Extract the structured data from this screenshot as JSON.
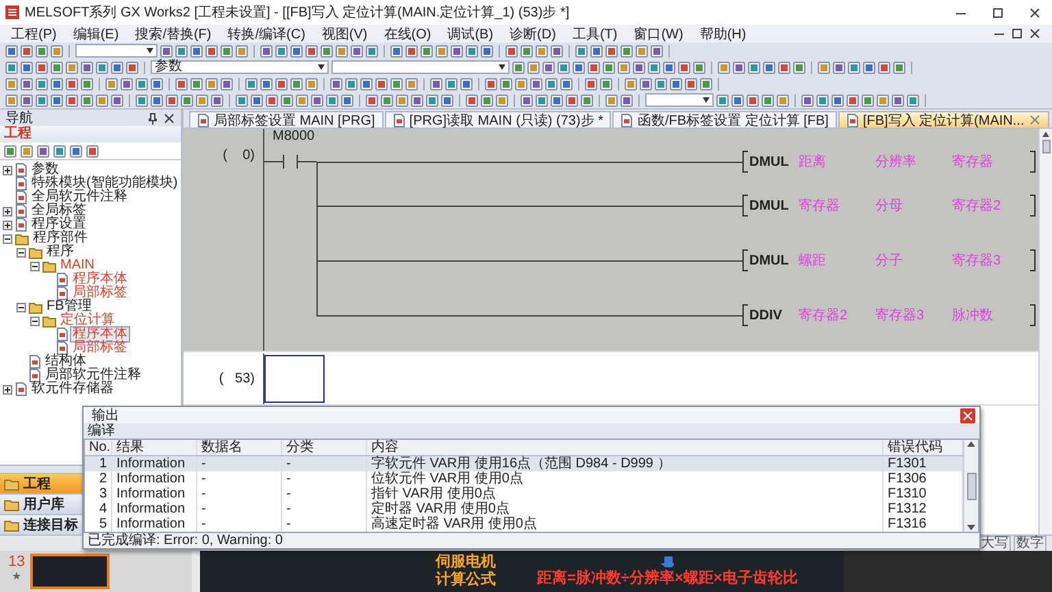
{
  "window": {
    "title": "MELSOFT系列 GX Works2 [工程未设置] - [[FB]写入 定位计算(MAIN.定位计算_1) (53)步 *]"
  },
  "menu": [
    "工程(P)",
    "编辑(E)",
    "搜索/替换(F)",
    "转换/编译(C)",
    "视图(V)",
    "在线(O)",
    "调试(B)",
    "诊断(D)",
    "工具(T)",
    "窗口(W)",
    "帮助(H)"
  ],
  "toolbar": {
    "search_field": {
      "value": "参数"
    }
  },
  "navigation": {
    "title": "导航",
    "section": "工程",
    "tree": [
      {
        "label": "参数",
        "expanded": false,
        "open": false,
        "selected": false
      },
      {
        "label": "特殊模块(智能功能模块)",
        "open": false,
        "selected": false
      },
      {
        "label": "全局软元件注释",
        "open": false,
        "selected": false
      },
      {
        "label": "全局标签",
        "expanded": false,
        "open": false,
        "selected": false
      },
      {
        "label": "程序设置",
        "expanded": false,
        "open": false,
        "selected": false
      },
      {
        "label": "程序部件",
        "expanded": true,
        "open": false,
        "selected": false,
        "children": [
          {
            "label": "程序",
            "expanded": true,
            "open": false,
            "selected": false,
            "children": [
              {
                "label": "MAIN",
                "expanded": true,
                "open": true,
                "selected": false,
                "children": [
                  {
                    "label": "程序本体",
                    "open": true,
                    "selected": false
                  },
                  {
                    "label": "局部标签",
                    "open": true,
                    "selected": false
                  }
                ]
              }
            ]
          },
          {
            "label": "FB管理",
            "expanded": true,
            "open": false,
            "selected": false,
            "children": [
              {
                "label": "定位计算",
                "expanded": true,
                "open": true,
                "selected": false,
                "children": [
                  {
                    "label": "程序本体",
                    "open": true,
                    "selected": true
                  },
                  {
                    "label": "局部标签",
                    "open": true,
                    "selected": false
                  }
                ]
              }
            ]
          },
          {
            "label": "结构体",
            "open": false,
            "selected": false
          },
          {
            "label": "局部软元件注释",
            "open": false,
            "selected": false
          }
        ]
      },
      {
        "label": "软元件存储器",
        "expanded": false,
        "open": false,
        "selected": false
      }
    ],
    "buttons": [
      {
        "label": "工程",
        "selected": true
      },
      {
        "label": "用户库",
        "selected": false
      },
      {
        "label": "连接目标",
        "selected": false
      }
    ]
  },
  "tabs": [
    {
      "label": "局部标签设置 MAIN [PRG]",
      "selected": false
    },
    {
      "label": "[PRG]读取 MAIN (只读) (73)步 *",
      "selected": false
    },
    {
      "label": "函数/FB标签设置 定位计算 [FB]",
      "selected": false
    },
    {
      "label": "[FB]写入 定位计算(MAIN...",
      "selected": true
    }
  ],
  "ladder": {
    "rungs": [
      {
        "step": "(    0)",
        "selected": false,
        "contact": "M8000",
        "instructions": [
          {
            "op": "DMUL",
            "operands": [
              "距离",
              "分辨率",
              "寄存器"
            ]
          },
          {
            "op": "DMUL",
            "operands": [
              "寄存器",
              "分母",
              "寄存器2"
            ]
          },
          {
            "op": "DMUL",
            "operands": [
              "螺距",
              "分子",
              "寄存器3"
            ]
          },
          {
            "op": "DDIV",
            "operands": [
              "寄存器2",
              "寄存器3",
              "脉冲数"
            ]
          }
        ]
      },
      {
        "step": "(   53)",
        "selected": true
      }
    ]
  },
  "output": {
    "title": "输出",
    "tab": "编译",
    "columns": [
      "No.",
      "结果",
      "数据名",
      "分类",
      "内容",
      "错误代码"
    ],
    "rows": [
      {
        "cells": [
          "1",
          "Information",
          "-",
          "-",
          "字软元件 VAR用 使用16点（范围 D984 - D999 ）",
          "F1301"
        ],
        "selected": true
      },
      {
        "cells": [
          "2",
          "Information",
          "-",
          "-",
          "位软元件 VAR用 使用0点",
          "F1306"
        ],
        "selected": false
      },
      {
        "cells": [
          "3",
          "Information",
          "-",
          "-",
          "指针 VAR用 使用0点",
          "F1310"
        ],
        "selected": false
      },
      {
        "cells": [
          "4",
          "Information",
          "-",
          "-",
          "定时器 VAR用 使用0点",
          "F1312"
        ],
        "selected": false
      },
      {
        "cells": [
          "5",
          "Information",
          "-",
          "-",
          "高速定时器 VAR用 使用0点",
          "F1316"
        ],
        "selected": false
      }
    ],
    "status": "已完成编译: Error: 0, Warning: 0"
  },
  "status_bar": [
    "大写",
    "数字"
  ],
  "slides": {
    "thumbnail": {
      "number": "13",
      "mark": "★",
      "selected": true
    },
    "slide": {
      "title_lines": [
        "伺服电机",
        "计算公式"
      ],
      "formula": "距离=脉冲数÷分辨率×螺距×电子齿轮比"
    }
  }
}
